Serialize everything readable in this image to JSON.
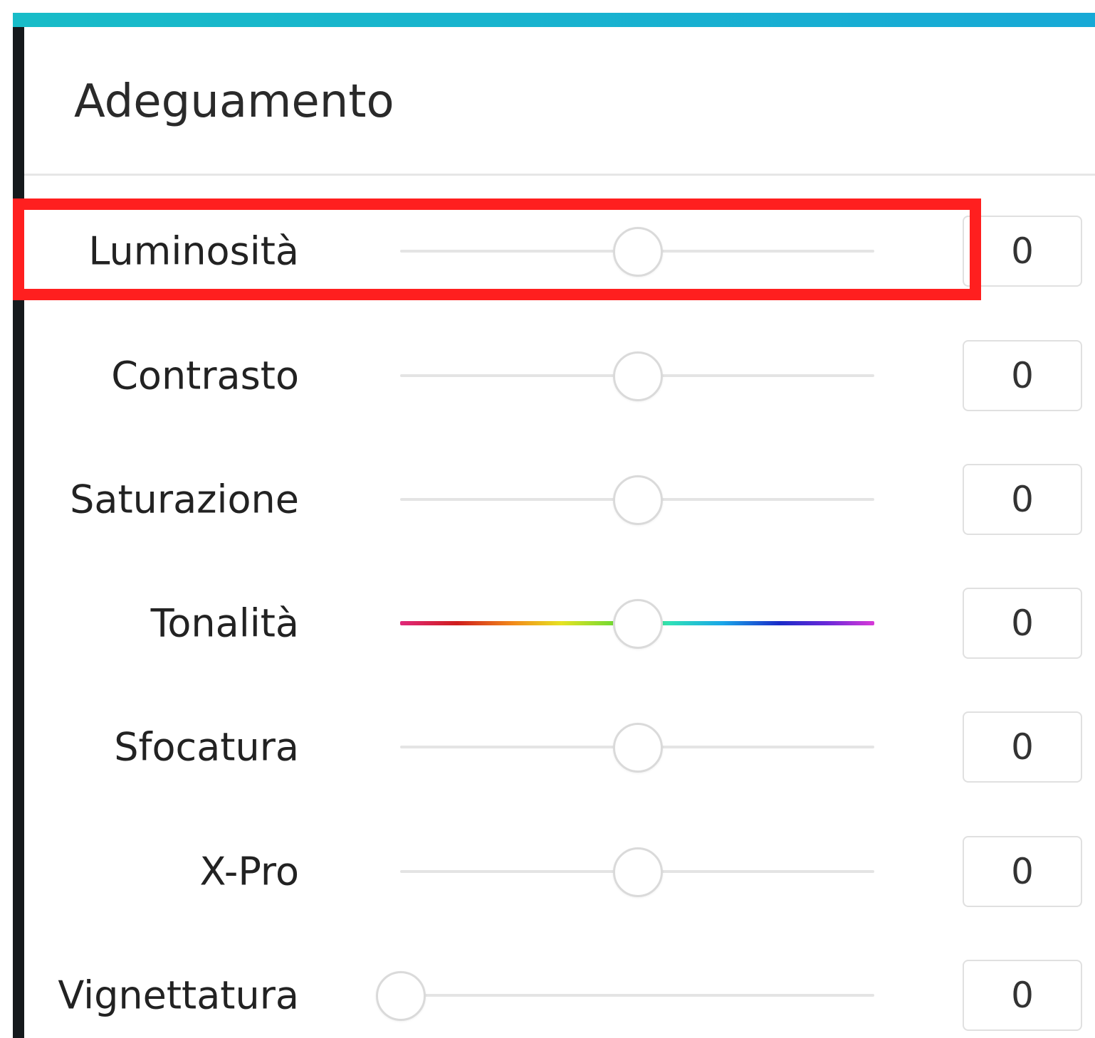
{
  "panel": {
    "title": "Adeguamento"
  },
  "adjustments": [
    {
      "label": "Luminosità",
      "value": "0",
      "level": 0.5,
      "track": "plain"
    },
    {
      "label": "Contrasto",
      "value": "0",
      "level": 0.5,
      "track": "plain"
    },
    {
      "label": "Saturazione",
      "value": "0",
      "level": 0.5,
      "track": "plain"
    },
    {
      "label": "Tonalità",
      "value": "0",
      "level": 0.5,
      "track": "rainbow"
    },
    {
      "label": "Sfocatura",
      "value": "0",
      "level": 0.5,
      "track": "plain"
    },
    {
      "label": "X-Pro",
      "value": "0",
      "level": 0.5,
      "track": "plain"
    },
    {
      "label": "Vignettatura",
      "value": "0",
      "level": 0.0,
      "track": "plain"
    }
  ],
  "highlight": {
    "target": "Luminosità",
    "color": "#ff1f1f"
  },
  "colors": {
    "accent": "#17a9d6",
    "rail": "#15191c",
    "track": "#e4e4e4"
  }
}
